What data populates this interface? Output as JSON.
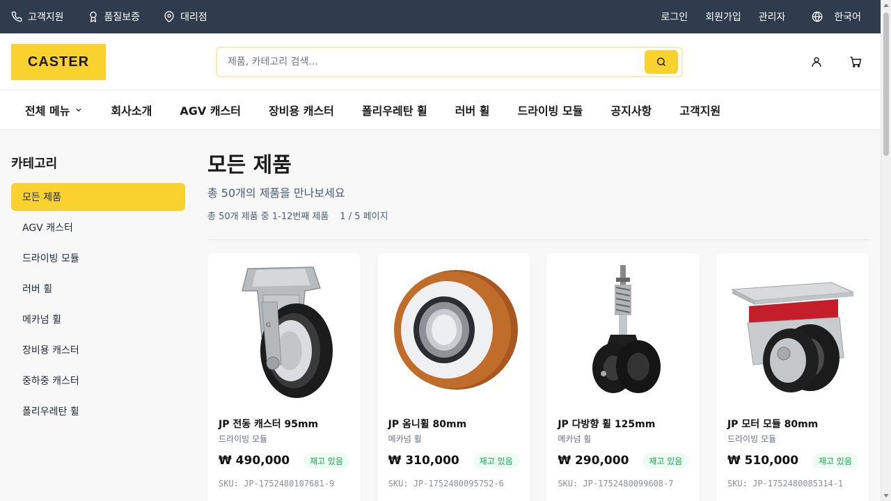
{
  "topbar": {
    "support": "고객지원",
    "quality": "품질보증",
    "dealer": "대리점",
    "login": "로그인",
    "signup": "회원가입",
    "admin": "관리자",
    "language": "한국어"
  },
  "header": {
    "logo": "CASTER",
    "search_placeholder": "제품, 카테고리 검색..."
  },
  "nav": {
    "all_menu": "전체 메뉴",
    "items": [
      "회사소개",
      "AGV 캐스터",
      "장비용 캐스터",
      "폴리우레탄 휠",
      "러버 휠",
      "드라이빙 모듈",
      "공지사항",
      "고객지원"
    ]
  },
  "sidebar": {
    "title": "카테고리",
    "items": [
      "모든 제품",
      "AGV 캐스터",
      "드라이빙 모듈",
      "러버 휠",
      "메카넘 휠",
      "장비용 캐스터",
      "중하중 캐스터",
      "폴리우레탄 휠"
    ]
  },
  "main": {
    "title": "모든 제품",
    "subtitle": "총 50개의 제품을 만나보세요",
    "count": "총 50개 제품 중 1-12번째 제품",
    "page": "1 / 5 페이지"
  },
  "products": [
    {
      "name": "JP 전동 캐스터 95mm",
      "category": "드라이빙 모듈",
      "price": "₩ 490,000",
      "stock": "재고 있음",
      "sku": "SKU: JP-1752480107681-9"
    },
    {
      "name": "JP 옴니휠 80mm",
      "category": "메카넘 휠",
      "price": "₩ 310,000",
      "stock": "재고 있음",
      "sku": "SKU: JP-1752480095752-6"
    },
    {
      "name": "JP 다방향 휠 125mm",
      "category": "메카넘 휠",
      "price": "₩ 290,000",
      "stock": "재고 있음",
      "sku": "SKU: JP-1752480099608-7"
    },
    {
      "name": "JP 모터 모듈 80mm",
      "category": "드라이빙 모듈",
      "price": "₩ 510,000",
      "stock": "재고 있음",
      "sku": "SKU: JP-1752480085314-1"
    }
  ],
  "colors": {
    "brand_yellow": "#f9d230",
    "topbar": "#2f3c4e",
    "stock_green": "#16a34a"
  }
}
